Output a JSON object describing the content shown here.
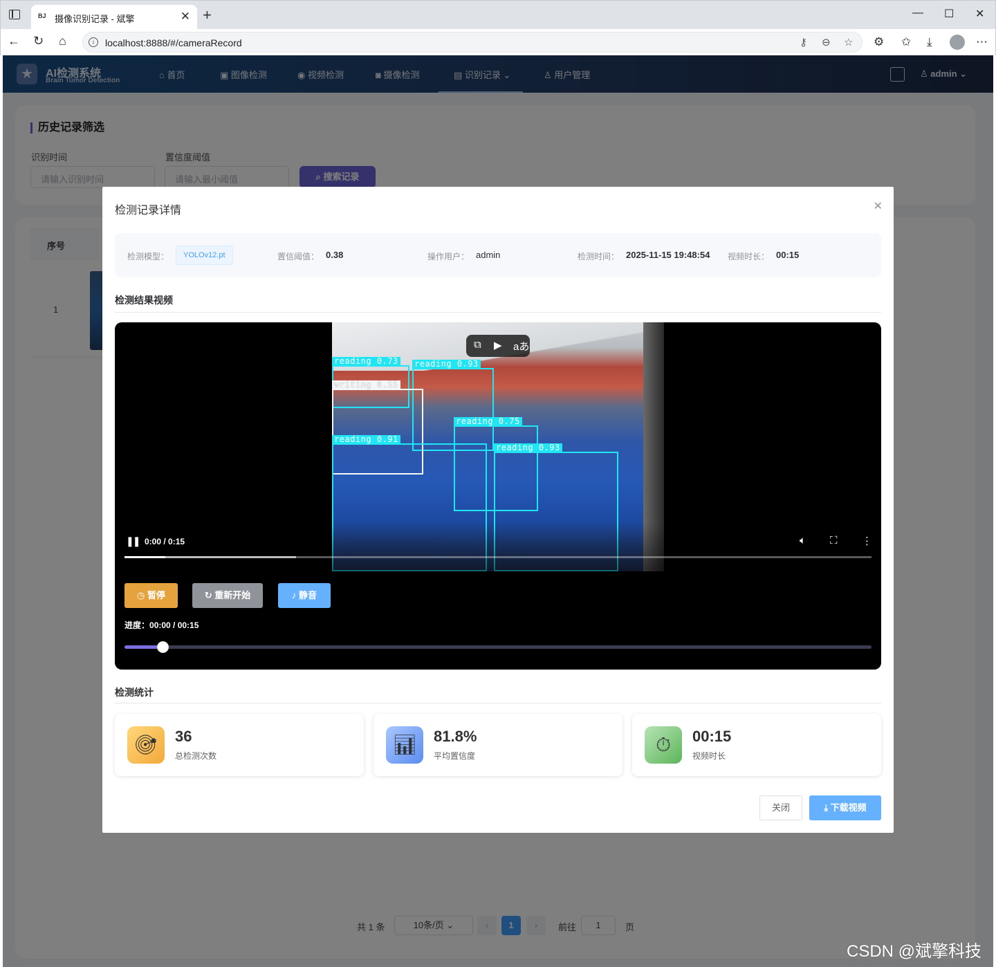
{
  "browser": {
    "tab_title": "摄像识别记录 - 斌擎",
    "tab_favicon": "BJ",
    "url": "localhost:8888/#/cameraRecord",
    "new_tab_label": "+",
    "close_tab_label": "✕"
  },
  "app": {
    "logo_title": "AI检测系统",
    "logo_subtitle": "Brain Tumor Detection",
    "nav": [
      {
        "label": "首页",
        "icon": "home-icon"
      },
      {
        "label": "图像检测",
        "icon": "image-icon"
      },
      {
        "label": "视频检测",
        "icon": "play-circle-icon"
      },
      {
        "label": "摄像检测",
        "icon": "camera-icon"
      },
      {
        "label": "识别记录",
        "icon": "document-icon",
        "active": true
      },
      {
        "label": "用户管理",
        "icon": "user-icon"
      }
    ],
    "user": "admin",
    "filter": {
      "title": "历史记录筛选",
      "time_label": "识别时间",
      "time_placeholder": "请输入识别时间",
      "conf_label": "置信度阈值",
      "conf_placeholder": "请输入最小阈值",
      "search_button": "搜索记录"
    },
    "table": {
      "header_seq": "序号",
      "rows": [
        {
          "seq": "1"
        }
      ]
    },
    "pagination": {
      "total": "共 1 条",
      "page_size": "10条/页",
      "current": "1",
      "goto_label": "前往",
      "goto_value": "1",
      "page_suffix": "页"
    }
  },
  "dialog": {
    "title": "检测记录详情",
    "info": {
      "model_label": "检测模型：",
      "model_value": "YOLOv12.pt",
      "threshold_label": "置信阈值：",
      "threshold_value": "0.38",
      "user_label": "操作用户：",
      "user_value": "admin",
      "time_label": "检测时间：",
      "time_value": "2025-11-15 19:48:54",
      "duration_label": "视频时长：",
      "duration_value": "00:15"
    },
    "video_section_title": "检测结果视频",
    "video": {
      "time_display": "0:00 / 0:15",
      "played_fraction": 0.055,
      "buffered_fraction": 0.23,
      "detections": [
        {
          "label": "reading",
          "score": "0.73",
          "color": "cyan"
        },
        {
          "label": "reading",
          "score": "0.93",
          "color": "cyan"
        },
        {
          "label": "writing",
          "score": "0.55",
          "color": "white"
        },
        {
          "label": "reading",
          "score": "0.75",
          "color": "cyan"
        },
        {
          "label": "reading",
          "score": "0.91",
          "color": "cyan"
        },
        {
          "label": "reading",
          "score": "0.93",
          "color": "cyan"
        }
      ],
      "pause_button": "暂停",
      "restart_button": "重新开始",
      "mute_button": "静音",
      "progress_label": "进度：",
      "progress_value": "00:00 / 00:15",
      "slider_fraction": 0.051
    },
    "stats_section_title": "检测统计",
    "stats": [
      {
        "value": "36",
        "label": "总检测次数",
        "icon": "target-icon"
      },
      {
        "value": "81.8%",
        "label": "平均置信度",
        "icon": "bar-chart-icon"
      },
      {
        "value": "00:15",
        "label": "视频时长",
        "icon": "stopwatch-icon"
      }
    ],
    "close_button": "关闭",
    "download_button": "下载视频"
  },
  "watermark": "CSDN @斌擎科技",
  "colors": {
    "primary": "#409eff",
    "accent_purple": "#6a64d6",
    "pause_button": "#e6a23c",
    "restart_button": "#909399",
    "mute_button": "#66b1ff",
    "detection_box": "#1fe6f2"
  }
}
